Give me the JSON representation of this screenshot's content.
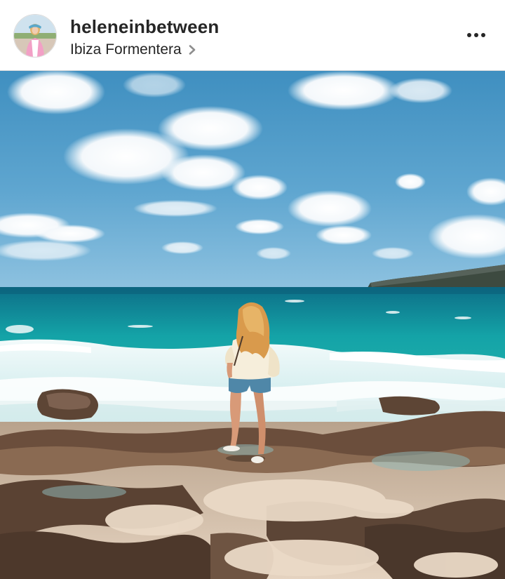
{
  "post": {
    "username": "heleneinbetween",
    "location": "Ibiza Formentera",
    "avatar_icon": "profile-photo",
    "location_chevron_icon": "chevron-right-icon",
    "more_icon": "more-options-icon",
    "photo_subject": "photo"
  },
  "colors": {
    "text_primary": "#262626",
    "divider": "#dbdbdb",
    "icon_gray": "#8e8e8e"
  }
}
